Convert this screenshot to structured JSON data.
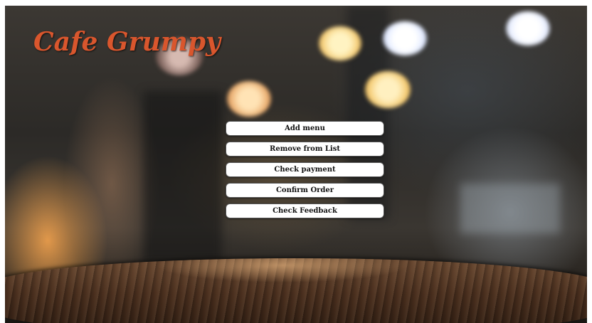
{
  "app": {
    "logo_text": "Cafe Grumpy"
  },
  "menu": {
    "items": [
      {
        "label": "Add menu"
      },
      {
        "label": "Remove from List"
      },
      {
        "label": "Check payment"
      },
      {
        "label": "Confirm Order"
      },
      {
        "label": "Check Feedback"
      }
    ]
  },
  "colors": {
    "logo": "#d9562d",
    "button_bg": "#ffffff",
    "button_text": "#111111"
  }
}
